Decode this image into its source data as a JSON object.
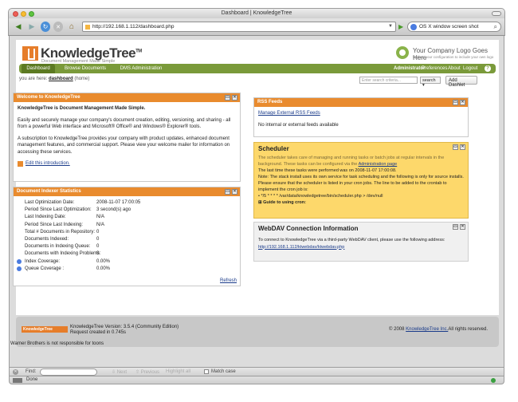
{
  "window": {
    "title": "Dashboard | KnowledgeTree"
  },
  "toolbar": {
    "url": "http://192.168.1.112/dashboard.php",
    "search_value": "OS X window screen shot"
  },
  "brand": {
    "name": "KnowledgeTree",
    "tm": "TM",
    "tagline": "Document Management Made Simple",
    "company_title": "Your Company Logo Goes Here",
    "company_sub": "Update your configuration to include your own logo"
  },
  "menu": {
    "tabs": [
      "Dashboard",
      "Browse Documents",
      "DMS Administration"
    ],
    "user": "Administrator",
    "links": [
      "Preferences",
      "About",
      "Logout"
    ]
  },
  "breadcrumb": {
    "prefix": "you are here:",
    "current": "dashboard",
    "suffix": "(home)"
  },
  "search": {
    "placeholder": "Enter search criteria...",
    "button": "search"
  },
  "add_dashlet": "Add Dashlet",
  "welcome": {
    "title": "Welcome to KnowledgeTree",
    "heading": "KnowledgeTree is Document Management Made Simple.",
    "p1": "Easily and securely manage your company's document creation, editing, versioning, and sharing - all from a powerful Web interface and Microsoft® Office® and Windows® Explorer® tools.",
    "p2": "A subscription to KnowledgeTree provides your company with product updates, enhanced document management features, and commercial support. Please view your welcome mailer for information on accessing these services.",
    "edit_link": "Edit this introduction."
  },
  "indexer": {
    "title": "Document Indexer Statistics",
    "rows": [
      {
        "label": "Last Optimization Date:",
        "value": "2008-11-07 17:00:05"
      },
      {
        "label": "Period Since Last Optimization:",
        "value": "3 second(s) ago"
      },
      {
        "label": "Last Indexing Date:",
        "value": "N/A"
      },
      {
        "label": "Period Since Last Indexing:",
        "value": "N/A"
      },
      {
        "label": "Total # Documents in Repository:",
        "value": "0"
      },
      {
        "label": "Documents Indexed:",
        "value": "0"
      },
      {
        "label": "Documents in Indexing Queue:",
        "value": "0"
      },
      {
        "label": "Documents with Indexing Problems:",
        "value": "0"
      },
      {
        "label": "Index Coverage:",
        "value": "0.00%"
      },
      {
        "label": "Queue Coverage :",
        "value": "0.00%"
      }
    ],
    "refresh": "Refresh"
  },
  "rss": {
    "title": "RSS Feeds",
    "manage_link": "Manage External RSS Feeds",
    "empty": "No internal or external feeds available"
  },
  "scheduler": {
    "title": "Scheduler",
    "intro": "The scheduler takes care of managing and running tasks or batch jobs at regular intervals in the background. These tasks can be configured via the",
    "intro_link": "Administration page",
    "last_run": "The last time these tasks were performed was on 2008-11-07 17:00:08.",
    "note": "Note: The stack install uses its own service for task scheduling and the following is only for source installs.",
    "ensure": "Please ensure that the scheduler is listed in your cron jobs. The line to be added to the crontab to implement the cron job is:",
    "cron_line": "*/5 * * * * /var/data/knowledgetree/bin/scheduler.php > /dev/null",
    "guide": "Guide to using cron:"
  },
  "webdav": {
    "title": "WebDAV Connection Information",
    "text": "To connect to KnowledgeTree via a third-party WebDAV client, please use the following address:",
    "url": "http://192.168.1.112/ktwebdav/ktwebdav.php"
  },
  "footer": {
    "logo": "KnowledgeTree",
    "version": "KnowledgeTree Version: 3.5.4 (Community Edition)",
    "request": "Request created in 0.745s",
    "copyright_prefix": "© 2008",
    "copyright_link": "KnowledgeTree Inc.",
    "copyright_suffix": "All rights reserved.",
    "toons": "Warner Brothers is not responsible for toons"
  },
  "findbar": {
    "label": "Find:",
    "next": "Next",
    "previous": "Previous",
    "highlight": "Highlight all",
    "match": "Match case"
  },
  "status": {
    "text": "Done"
  },
  "colors": {
    "accent": "#e98b2e",
    "menu": "#7a9a3a",
    "scheduler_bg": "#fdd86b"
  }
}
